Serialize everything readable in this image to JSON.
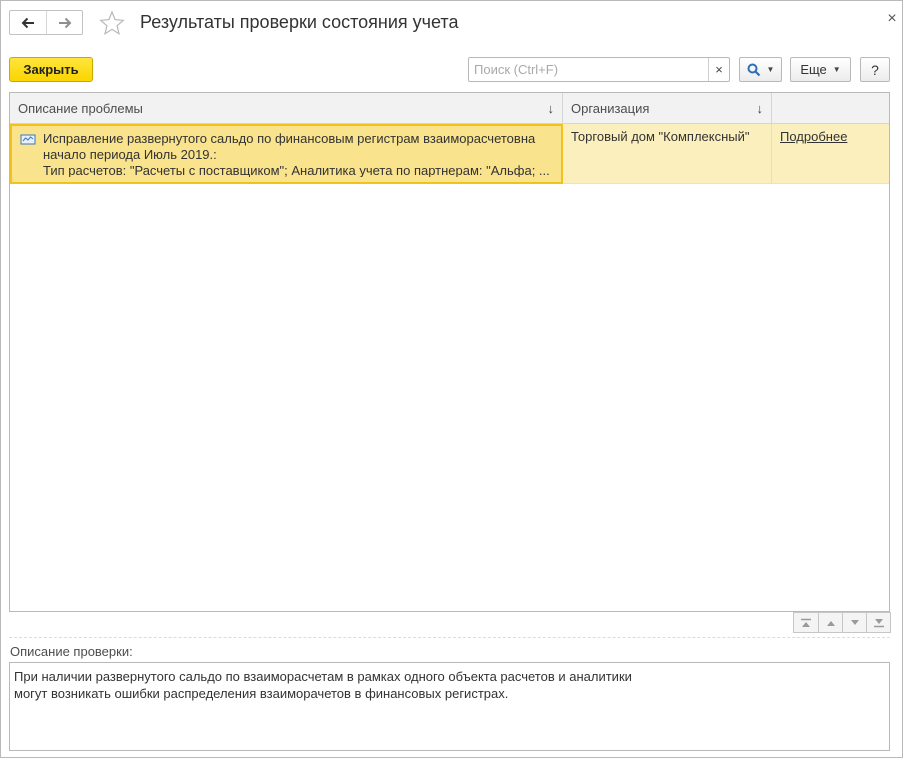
{
  "window": {
    "title": "Результаты проверки состояния учета",
    "close_glyph": "×"
  },
  "toolbar": {
    "close_label": "Закрыть",
    "search_placeholder": "Поиск (Ctrl+F)",
    "search_value": "",
    "clear_glyph": "×",
    "more_label": "Еще",
    "help_label": "?"
  },
  "table": {
    "columns": {
      "description": "Описание проблемы",
      "organization": "Организация",
      "link": ""
    },
    "rows": [
      {
        "description_lines": [
          "Исправление развернутого сальдо по финансовым регистрам взаиморасчетовна",
          "начало периода Июль 2019.:",
          "Тип расчетов: \"Расчеты с поставщиком\"; Аналитика учета по партнерам: \"Альфа; ..."
        ],
        "organization": "Торговый дом \"Комплексный\"",
        "link": "Подробнее"
      }
    ]
  },
  "check_description": {
    "label": "Описание проверки:",
    "lines": [
      "При наличии развернутого сальдо по взаиморасчетам в рамках одного объекта расчетов и аналитики",
      "могут возникать ошибки распределения взаиморачетов в финансовых регистрах."
    ]
  },
  "colors": {
    "accent_button": "#f9d500",
    "selected_row": "#fbf0bd",
    "selected_cell": "#f9e38c",
    "selected_border": "#f2c21a"
  }
}
